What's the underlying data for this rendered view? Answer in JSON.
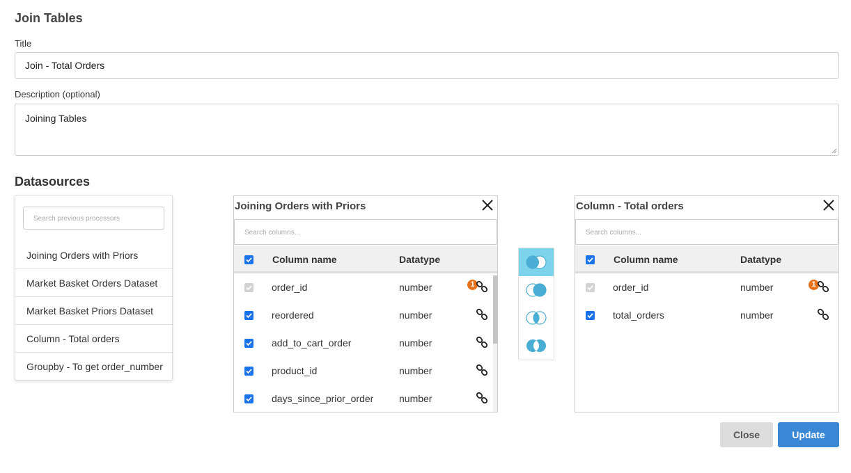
{
  "page": {
    "title": "Join Tables"
  },
  "form": {
    "title_label": "Title",
    "title_value": "Join - Total Orders",
    "description_label": "Description (optional)",
    "description_value": "Joining Tables"
  },
  "datasources": {
    "heading": "Datasources",
    "search_placeholder": "Search previous processors",
    "items": [
      {
        "label": "Joining Orders with Priors"
      },
      {
        "label": "Market Basket Orders Dataset"
      },
      {
        "label": "Market Basket Priors Dataset"
      },
      {
        "label": "Column - Total orders"
      },
      {
        "label": "Groupby - To get order_number"
      }
    ]
  },
  "left_table": {
    "title": "Joining Orders with Priors",
    "search_placeholder": "Search columns...",
    "headers": {
      "name": "Column name",
      "type": "Datatype"
    },
    "rows": [
      {
        "name": "order_id",
        "type": "number",
        "checked": true,
        "disabled": true,
        "badge": "1"
      },
      {
        "name": "reordered",
        "type": "number",
        "checked": true,
        "disabled": false
      },
      {
        "name": "add_to_cart_order",
        "type": "number",
        "checked": true,
        "disabled": false
      },
      {
        "name": "product_id",
        "type": "number",
        "checked": true,
        "disabled": false
      },
      {
        "name": "days_since_prior_order",
        "type": "number",
        "checked": true,
        "disabled": false
      }
    ]
  },
  "right_table": {
    "title": "Column - Total orders",
    "search_placeholder": "Search columns...",
    "headers": {
      "name": "Column name",
      "type": "Datatype"
    },
    "rows": [
      {
        "name": "order_id",
        "type": "number",
        "checked": true,
        "disabled": true,
        "badge": "1"
      },
      {
        "name": "total_orders",
        "type": "number",
        "checked": true,
        "disabled": false
      }
    ]
  },
  "join_types": {
    "selected": "left-join",
    "options": [
      "left-join-icon",
      "right-join-icon",
      "inner-join-icon",
      "outer-join-icon"
    ]
  },
  "buttons": {
    "close": "Close",
    "update": "Update"
  },
  "colors": {
    "primary": "#3a87d6",
    "checkbox": "#1a73e8",
    "join_selected": "#7cd3ec",
    "badge": "#e8711c"
  }
}
